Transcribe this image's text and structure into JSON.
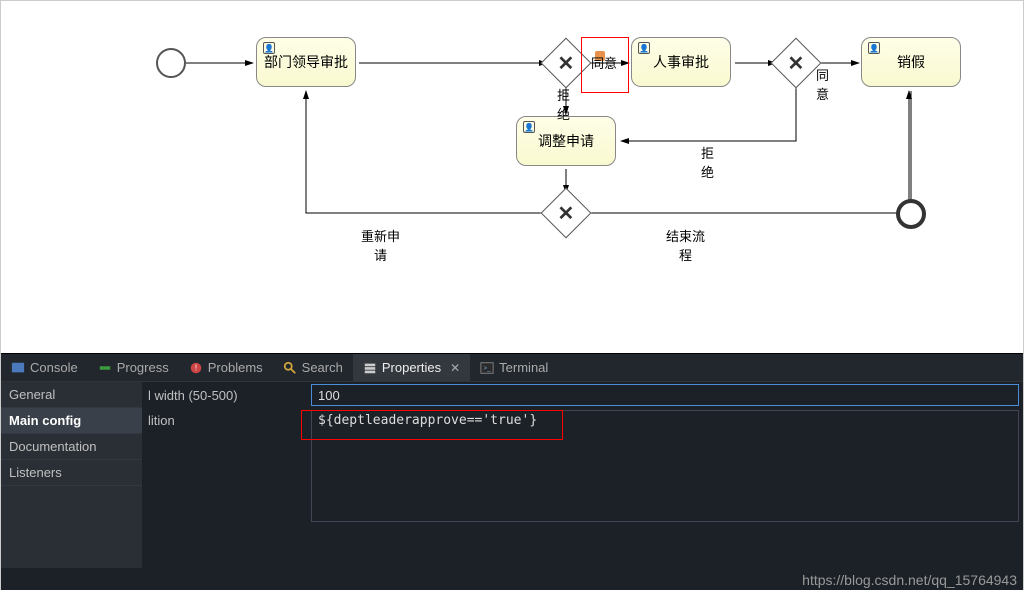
{
  "diagram": {
    "task1": "部门领导审批",
    "task2": "人事审批",
    "task3": "调整申请",
    "task4": "销假",
    "label_agree1": "同意",
    "label_reject1": "拒\n绝",
    "label_agree2": "同\n意",
    "label_reject2": "拒\n绝",
    "label_resubmit": "重新申\n请",
    "label_endflow": "结束流\n程"
  },
  "tabs": {
    "console": "Console",
    "progress": "Progress",
    "problems": "Problems",
    "search": "Search",
    "properties": "Properties",
    "terminal": "Terminal"
  },
  "sidebar": {
    "general": "General",
    "main_config": "Main config",
    "documentation": "Documentation",
    "listeners": "Listeners"
  },
  "fields": {
    "width_label": "l width (50-500)",
    "width_value": "100",
    "condition_label": "lition",
    "condition_value": "${deptleaderapprove=='true'}"
  },
  "watermark": "https://blog.csdn.net/qq_15764943"
}
